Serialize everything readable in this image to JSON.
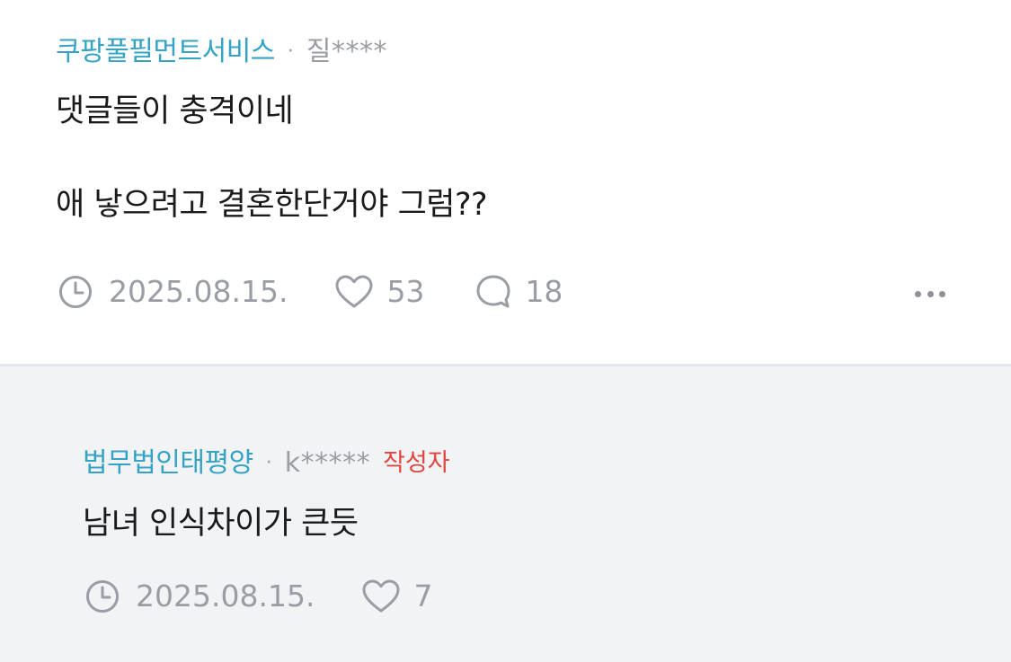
{
  "comment": {
    "company": "쿠팡풀필먼트서비스",
    "separator": "·",
    "username": "질****",
    "text": "댓글들이 충격이네\n\n애 낳으려고 결혼한단거야 그럼??",
    "date": "2025.08.15.",
    "likes": "53",
    "replies": "18"
  },
  "reply": {
    "company": "법무법인태평양",
    "separator": "·",
    "username": "k*****",
    "author_badge": "작성자",
    "text": "남녀 인식차이가 큰듯",
    "date": "2025.08.15.",
    "likes": "7"
  },
  "icons": {
    "time": "clock-icon",
    "like": "heart-icon",
    "reply": "speech-bubble-icon",
    "more": "more-dots-icon"
  },
  "colors": {
    "company": "#35a3c6",
    "muted": "#9a9da3",
    "author_badge": "#e0463f",
    "reply_background": "#f2f3f5"
  }
}
